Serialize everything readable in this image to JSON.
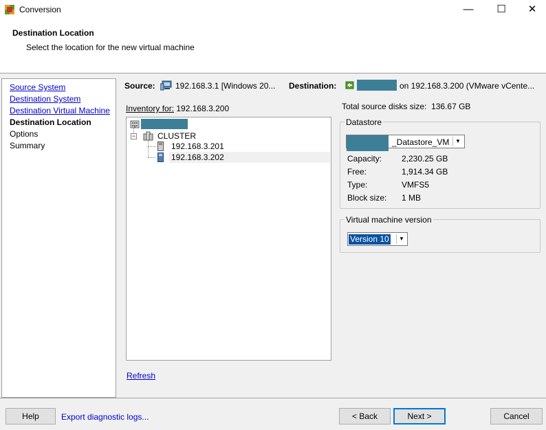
{
  "window": {
    "title": "Conversion",
    "controls": {
      "minimize": "—",
      "maximize": "☐",
      "close": "✕"
    }
  },
  "header": {
    "title": "Destination Location",
    "subtitle": "Select the location for the new virtual machine"
  },
  "nav": {
    "items": [
      {
        "label": "Source System",
        "state": "link"
      },
      {
        "label": "Destination System",
        "state": "link"
      },
      {
        "label": "Destination Virtual Machine",
        "state": "link"
      },
      {
        "label": "Destination Location",
        "state": "current"
      },
      {
        "label": "Options",
        "state": "plain"
      },
      {
        "label": "Summary",
        "state": "plain"
      }
    ]
  },
  "summary": {
    "source_label": "Source:",
    "source_value": "192.168.3.1 [Windows 20...",
    "destination_label": "Destination:",
    "destination_value": "on 192.168.3.200 (VMware vCente..."
  },
  "inventory": {
    "label": "Inventory for:",
    "host": "192.168.3.200",
    "tree": {
      "cluster": "CLUSTER",
      "hosts": [
        "192.168.3.201",
        "192.168.3.202"
      ]
    }
  },
  "refresh_label": "Refresh",
  "disks": {
    "label": "Total source disks size:",
    "value": "136.67 GB"
  },
  "datastore": {
    "legend": "Datastore",
    "selected_suffix": "_Datastore_VM",
    "fields": [
      {
        "label": "Capacity:",
        "value": "2,230.25 GB"
      },
      {
        "label": "Free:",
        "value": "1,914.34 GB"
      },
      {
        "label": "Type:",
        "value": "VMFS5"
      },
      {
        "label": "Block size:",
        "value": "1 MB"
      }
    ]
  },
  "vm_version": {
    "legend": "Virtual machine version",
    "selected": "Version 10"
  },
  "footer": {
    "help": "Help",
    "export": "Export diagnostic logs...",
    "back": "< Back",
    "next": "Next >",
    "cancel": "Cancel"
  },
  "colors": {
    "redaction": "#3d7f96",
    "link": "#0000cc",
    "selection": "#0a52a4",
    "focus_border": "#0078d7"
  }
}
